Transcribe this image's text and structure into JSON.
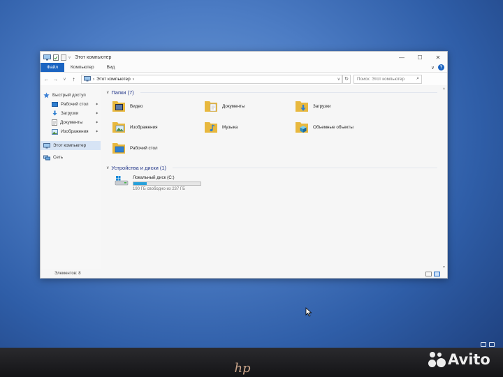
{
  "window": {
    "title": "Этот компьютер",
    "controls": {
      "minimize": "—",
      "maximize": "☐",
      "close": "✕"
    }
  },
  "ribbon": {
    "tabs": [
      "Файл",
      "Компьютер",
      "Вид"
    ],
    "expand_glyph": "∨",
    "help": "?"
  },
  "nav": {
    "back": "←",
    "forward": "→",
    "recent": "∨",
    "up": "↑",
    "address": {
      "separator": "›",
      "location": "Этот компьютер",
      "trail": "›",
      "dropdown": "∨"
    },
    "refresh": "↻",
    "search": {
      "placeholder": "Поиск: Этот компьютер",
      "icon": "⌕"
    }
  },
  "sidebar": {
    "quick_access": "Быстрый доступ",
    "pinned": [
      {
        "label": "Рабочий стол",
        "icon": "desktop-icon"
      },
      {
        "label": "Загрузки",
        "icon": "download-icon"
      },
      {
        "label": "Документы",
        "icon": "documents-icon"
      },
      {
        "label": "Изображения",
        "icon": "pictures-icon"
      }
    ],
    "pin_glyph": "📌",
    "this_pc": "Этот компьютер",
    "network": "Сеть"
  },
  "folders_group": {
    "title": "Папки (7)",
    "items": [
      {
        "label": "Видео",
        "icon": "videos-folder-icon"
      },
      {
        "label": "Документы",
        "icon": "documents-folder-icon"
      },
      {
        "label": "Загрузки",
        "icon": "downloads-folder-icon"
      },
      {
        "label": "Изображения",
        "icon": "pictures-folder-icon"
      },
      {
        "label": "Музыка",
        "icon": "music-folder-icon"
      },
      {
        "label": "Объемные объекты",
        "icon": "3d-objects-folder-icon"
      },
      {
        "label": "Рабочий стол",
        "icon": "desktop-folder-icon"
      }
    ]
  },
  "drives_group": {
    "title": "Устройства и диски (1)",
    "drives": [
      {
        "label": "Локальный диск (C:)",
        "free_text": "190 ГБ свободно из 237 ГБ",
        "used_fraction": 0.2,
        "bar_color": "#26a0da"
      }
    ]
  },
  "status": {
    "items_count": "Элементов: 8"
  },
  "scroll": {
    "up": "▲",
    "down": "▼"
  },
  "branding": {
    "laptop_logo": "hp",
    "watermark": "Avito"
  },
  "colors": {
    "accent": "#1b64c1",
    "folder": "#e8b83e",
    "header": "#1e3287"
  }
}
